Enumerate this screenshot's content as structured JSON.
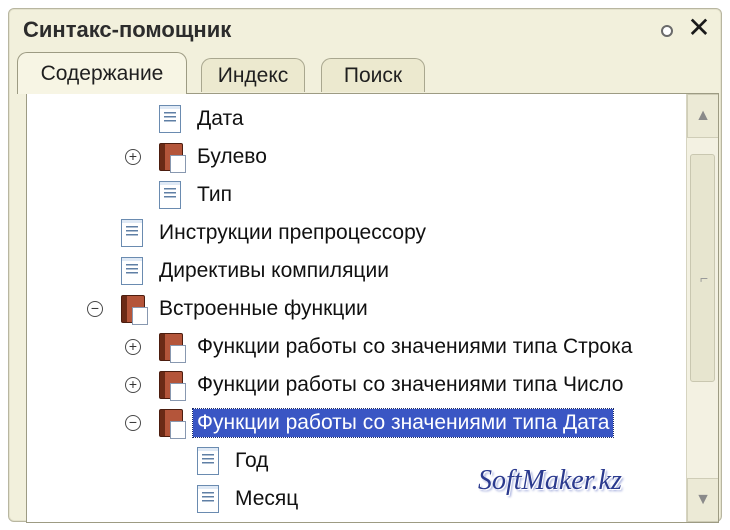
{
  "window": {
    "title": "Синтакс-помощник",
    "close_glyph": "✕",
    "pin_icon": "pin-icon"
  },
  "tabs": [
    {
      "label": "Содержание",
      "active": true
    },
    {
      "label": "Индекс",
      "active": false
    },
    {
      "label": "Поиск",
      "active": false
    }
  ],
  "tree": [
    {
      "label": "Дата",
      "icon": "page-icon",
      "expander": null,
      "level": 2
    },
    {
      "label": "Булево",
      "icon": "book-icon",
      "expander": "+",
      "level": 2
    },
    {
      "label": "Тип",
      "icon": "page-icon",
      "expander": null,
      "level": 2
    },
    {
      "label": "Инструкции препроцессору",
      "icon": "page-icon",
      "expander": null,
      "level": 1
    },
    {
      "label": "Директивы компиляции",
      "icon": "page-icon",
      "expander": null,
      "level": 1
    },
    {
      "label": "Встроенные функции",
      "icon": "book-icon",
      "expander": "−",
      "level": 1
    },
    {
      "label": "Функции работы со значениями типа Строка",
      "icon": "book-icon",
      "expander": "+",
      "level": 2
    },
    {
      "label": "Функции работы со значениями типа Число",
      "icon": "book-icon",
      "expander": "+",
      "level": 2
    },
    {
      "label": "Функции работы со значениями типа Дата",
      "icon": "book-icon",
      "expander": "−",
      "level": 2,
      "selected": true
    },
    {
      "label": "Год",
      "icon": "page-icon",
      "expander": null,
      "level": 3
    },
    {
      "label": "Месяц",
      "icon": "page-icon",
      "expander": null,
      "level": 3
    }
  ],
  "scrollbar": {
    "up_glyph": "▲",
    "down_glyph": "▼",
    "grip_glyph": "⌐"
  },
  "watermark": "SoftMaker.kz",
  "colors": {
    "selection": "#3a56c4",
    "window_bg": "#f2f0dc",
    "book_icon": "#b4553a",
    "page_icon_lines": "#5f7fa5"
  }
}
